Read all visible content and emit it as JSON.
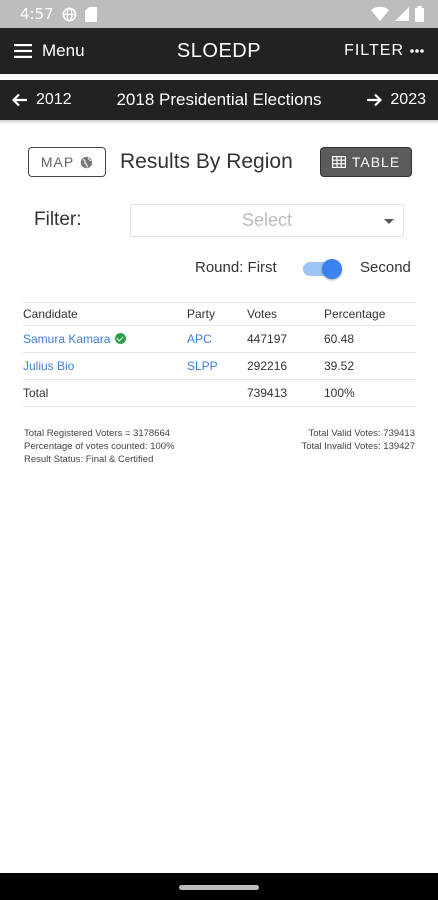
{
  "status_bar": {
    "time": "4:57",
    "icons": [
      "globe-icon",
      "sd-card-icon",
      "wifi-icon",
      "signal-icon",
      "battery-icon"
    ]
  },
  "app_bar": {
    "menu_label": "Menu",
    "title": "SLOEDP",
    "filter_label": "FILTER",
    "color": "#222222"
  },
  "year_nav": {
    "prev_year": "2012",
    "title": "2018 Presidential Elections",
    "next_year": "2023"
  },
  "view": {
    "map_label": "MAP",
    "title": "Results By Region",
    "table_label": "TABLE"
  },
  "filter": {
    "label": "Filter:",
    "placeholder": "Select"
  },
  "round": {
    "label": "Round: First",
    "second_label": "Second",
    "selected": "Second",
    "accent_color": "#3a82f0"
  },
  "table": {
    "headers": {
      "candidate": "Candidate",
      "party": "Party",
      "votes": "Votes",
      "percentage": "Percentage"
    },
    "rows": [
      {
        "candidate": "Samura Kamara",
        "party": "APC",
        "votes": "447197",
        "percentage": "60.48",
        "winner": true
      },
      {
        "candidate": "Julius Bio",
        "party": "SLPP",
        "votes": "292216",
        "percentage": "39.52",
        "winner": false
      }
    ],
    "total": {
      "label": "Total",
      "votes": "739413",
      "percentage": "100%"
    },
    "link_color": "#3f7fd4"
  },
  "summary": {
    "registered": "Total Registered Voters = 3178664",
    "counted": "Percentage of votes counted: 100%",
    "status": "Result Status: Final & Certified",
    "valid": "Total Valid Votes: 739413",
    "invalid": "Total Invalid Votes: 139427"
  }
}
